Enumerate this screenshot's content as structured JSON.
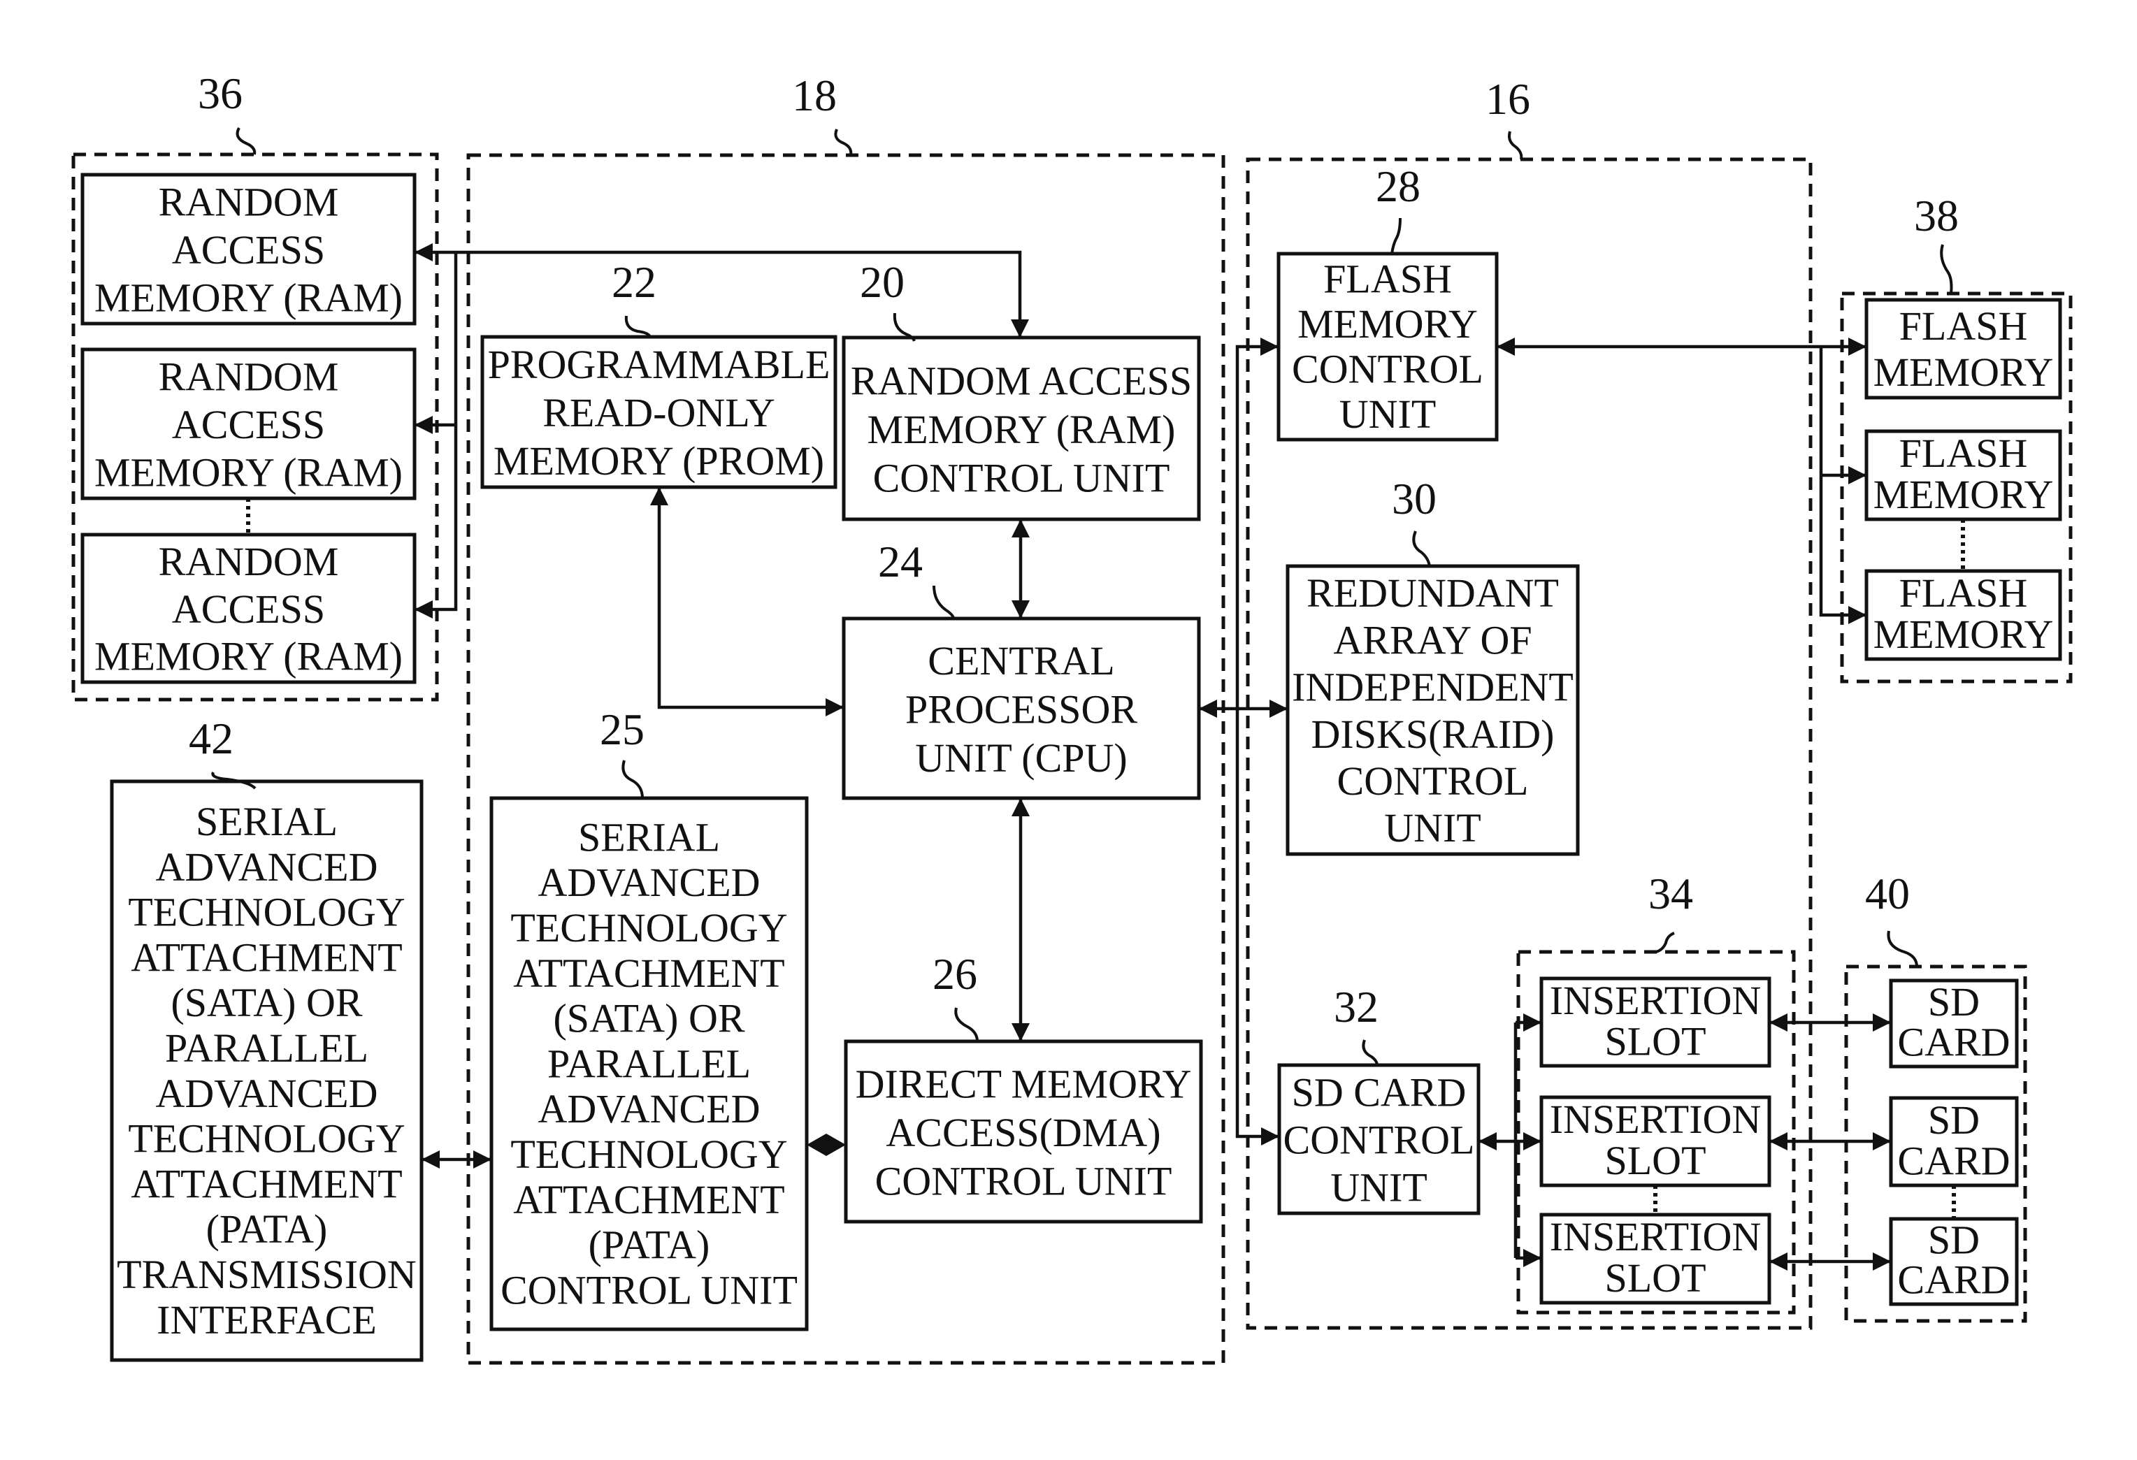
{
  "figure": {
    "description": "Block diagram of storage controller system",
    "groups": [
      {
        "id": "g36",
        "ref": "36",
        "name": "ram-group"
      },
      {
        "id": "g18",
        "ref": "18",
        "name": "main-controller-group"
      },
      {
        "id": "g16",
        "ref": "16",
        "name": "storage-controller-group"
      },
      {
        "id": "g38",
        "ref": "38",
        "name": "flash-memory-group"
      },
      {
        "id": "g34",
        "ref": "34",
        "name": "insertion-slot-group"
      },
      {
        "id": "g40",
        "ref": "40",
        "name": "sd-card-group"
      }
    ],
    "blocks": [
      {
        "id": "ram1",
        "name": "ram-module",
        "lines": [
          "RANDOM",
          "ACCESS",
          "MEMORY (RAM)"
        ]
      },
      {
        "id": "ram2",
        "name": "ram-module",
        "lines": [
          "RANDOM",
          "ACCESS",
          "MEMORY (RAM)"
        ]
      },
      {
        "id": "ram3",
        "name": "ram-module",
        "lines": [
          "RANDOM",
          "ACCESS",
          "MEMORY (RAM)"
        ]
      },
      {
        "id": "prom",
        "ref": "22",
        "name": "prom-block",
        "lines": [
          "PROGRAMMABLE",
          "READ-ONLY",
          "MEMORY (PROM)"
        ]
      },
      {
        "id": "ramctl",
        "ref": "20",
        "name": "ram-control-unit",
        "lines": [
          "RANDOM ACCESS",
          "MEMORY (RAM)",
          "CONTROL UNIT"
        ]
      },
      {
        "id": "cpu",
        "ref": "24",
        "name": "cpu-block",
        "lines": [
          "CENTRAL",
          "PROCESSOR",
          "UNIT  (CPU)"
        ]
      },
      {
        "id": "satactl",
        "ref": "25",
        "name": "sata-pata-control-unit",
        "lines": [
          "SERIAL",
          "ADVANCED",
          "TECHNOLOGY",
          "ATTACHMENT",
          "(SATA) OR",
          "PARALLEL",
          "ADVANCED",
          "TECHNOLOGY",
          "ATTACHMENT",
          "(PATA)",
          "CONTROL UNIT"
        ]
      },
      {
        "id": "dma",
        "ref": "26",
        "name": "dma-control-unit",
        "lines": [
          "DIRECT MEMORY",
          "ACCESS(DMA)",
          "CONTROL UNIT"
        ]
      },
      {
        "id": "sataif",
        "ref": "42",
        "name": "sata-pata-transmission-interface",
        "lines": [
          "SERIAL",
          "ADVANCED",
          "TECHNOLOGY",
          "ATTACHMENT",
          "(SATA) OR",
          "PARALLEL",
          "ADVANCED",
          "TECHNOLOGY",
          "ATTACHMENT",
          "(PATA)",
          "TRANSMISSION",
          "INTERFACE"
        ]
      },
      {
        "id": "flashctl",
        "ref": "28",
        "name": "flash-memory-control-unit",
        "lines": [
          "FLASH",
          "MEMORY",
          "CONTROL",
          "UNIT"
        ]
      },
      {
        "id": "raid",
        "ref": "30",
        "name": "raid-control-unit",
        "lines": [
          "REDUNDANT",
          "ARRAY OF",
          "INDEPENDENT",
          "DISKS(RAID)",
          "CONTROL",
          "UNIT"
        ]
      },
      {
        "id": "sdctl",
        "ref": "32",
        "name": "sd-card-control-unit",
        "lines": [
          "SD CARD",
          "CONTROL",
          "UNIT"
        ]
      },
      {
        "id": "flash1",
        "name": "flash-memory",
        "lines": [
          "FLASH",
          "MEMORY"
        ]
      },
      {
        "id": "flash2",
        "name": "flash-memory",
        "lines": [
          "FLASH",
          "MEMORY"
        ]
      },
      {
        "id": "flash3",
        "name": "flash-memory",
        "lines": [
          "FLASH",
          "MEMORY"
        ]
      },
      {
        "id": "slot1",
        "name": "insertion-slot",
        "lines": [
          "INSERTION",
          "SLOT"
        ]
      },
      {
        "id": "slot2",
        "name": "insertion-slot",
        "lines": [
          "INSERTION",
          "SLOT"
        ]
      },
      {
        "id": "slot3",
        "name": "insertion-slot",
        "lines": [
          "INSERTION",
          "SLOT"
        ]
      },
      {
        "id": "sd1",
        "name": "sd-card",
        "lines": [
          "SD",
          "CARD"
        ]
      },
      {
        "id": "sd2",
        "name": "sd-card",
        "lines": [
          "SD",
          "CARD"
        ]
      },
      {
        "id": "sd3",
        "name": "sd-card",
        "lines": [
          "SD",
          "CARD"
        ]
      }
    ],
    "connections": [
      {
        "from": "ramctl",
        "to": "ram1",
        "type": "bus"
      },
      {
        "from": "ramctl",
        "to": "ram2",
        "type": "bus"
      },
      {
        "from": "ramctl",
        "to": "ram3",
        "type": "bus"
      },
      {
        "from": "cpu",
        "to": "ramctl",
        "type": "bidirectional"
      },
      {
        "from": "cpu",
        "to": "prom",
        "type": "bidirectional"
      },
      {
        "from": "cpu",
        "to": "dma",
        "type": "bidirectional"
      },
      {
        "from": "dma",
        "to": "satactl",
        "type": "bidirectional"
      },
      {
        "from": "sataif",
        "to": "satactl",
        "type": "bidirectional"
      },
      {
        "from": "cpu",
        "to": "flashctl",
        "type": "bus"
      },
      {
        "from": "cpu",
        "to": "raid",
        "type": "bidirectional"
      },
      {
        "from": "cpu",
        "to": "sdctl",
        "type": "bus"
      },
      {
        "from": "flashctl",
        "to": "flash1",
        "type": "bidirectional"
      },
      {
        "from": "flashctl",
        "to": "flash2",
        "type": "bus"
      },
      {
        "from": "flashctl",
        "to": "flash3",
        "type": "bus"
      },
      {
        "from": "sdctl",
        "to": "slot1",
        "type": "bus"
      },
      {
        "from": "sdctl",
        "to": "slot2",
        "type": "bidirectional"
      },
      {
        "from": "sdctl",
        "to": "slot3",
        "type": "bus"
      },
      {
        "from": "slot1",
        "to": "sd1",
        "type": "bidirectional"
      },
      {
        "from": "slot2",
        "to": "sd2",
        "type": "bidirectional"
      },
      {
        "from": "slot3",
        "to": "sd3",
        "type": "bidirectional"
      }
    ]
  }
}
